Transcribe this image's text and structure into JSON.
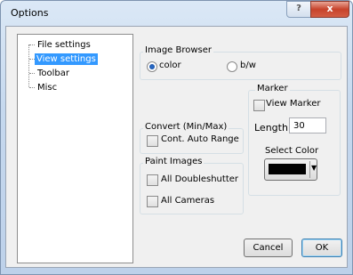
{
  "window": {
    "title": "Options",
    "help_glyph": "?",
    "close_glyph": "x"
  },
  "tree": {
    "items": [
      "File settings",
      "View settings",
      "Toolbar",
      "Misc"
    ],
    "selected": "View settings"
  },
  "image_browser": {
    "label": "Image Browser",
    "options": [
      "color",
      "b/w"
    ],
    "selected": "color"
  },
  "marker": {
    "label": "Marker",
    "view_marker_label": "View Marker",
    "view_marker_checked": false,
    "length_label": "Length",
    "length_value": "30",
    "select_color_label": "Select Color",
    "color": "#000000"
  },
  "convert": {
    "label": "Convert (Min/Max)",
    "cont_auto_range_label": "Cont. Auto Range",
    "checked": false
  },
  "paint_images": {
    "label": "Paint Images",
    "all_doubleshutter_label": "All Doubleshutter",
    "all_cameras_label": "All Cameras"
  },
  "buttons": {
    "cancel": "Cancel",
    "ok": "OK"
  },
  "icons": {
    "help": "help-icon",
    "close": "close-icon",
    "dropdown": "chevron-down-icon"
  }
}
